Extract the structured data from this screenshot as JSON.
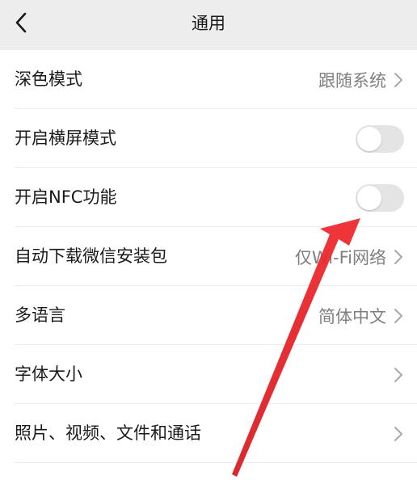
{
  "header": {
    "title": "通用"
  },
  "rows": [
    {
      "label": "深色模式",
      "value": "跟随系统"
    },
    {
      "label": "开启横屏模式",
      "toggle_on": false
    },
    {
      "label": "开启NFC功能",
      "toggle_on": false
    },
    {
      "label": "自动下载微信安装包",
      "value": "仅Wi-Fi网络"
    },
    {
      "label": "多语言",
      "value": "简体中文"
    },
    {
      "label": "字体大小"
    },
    {
      "label": "照片、视频、文件和通话"
    }
  ],
  "colors": {
    "header_bg": "#ededed",
    "toggle_off": "#e4e4e4",
    "annotation_arrow": "#e8242a"
  },
  "icons": {
    "back": "chevron-left-icon",
    "row_arrow": "chevron-right-icon"
  }
}
